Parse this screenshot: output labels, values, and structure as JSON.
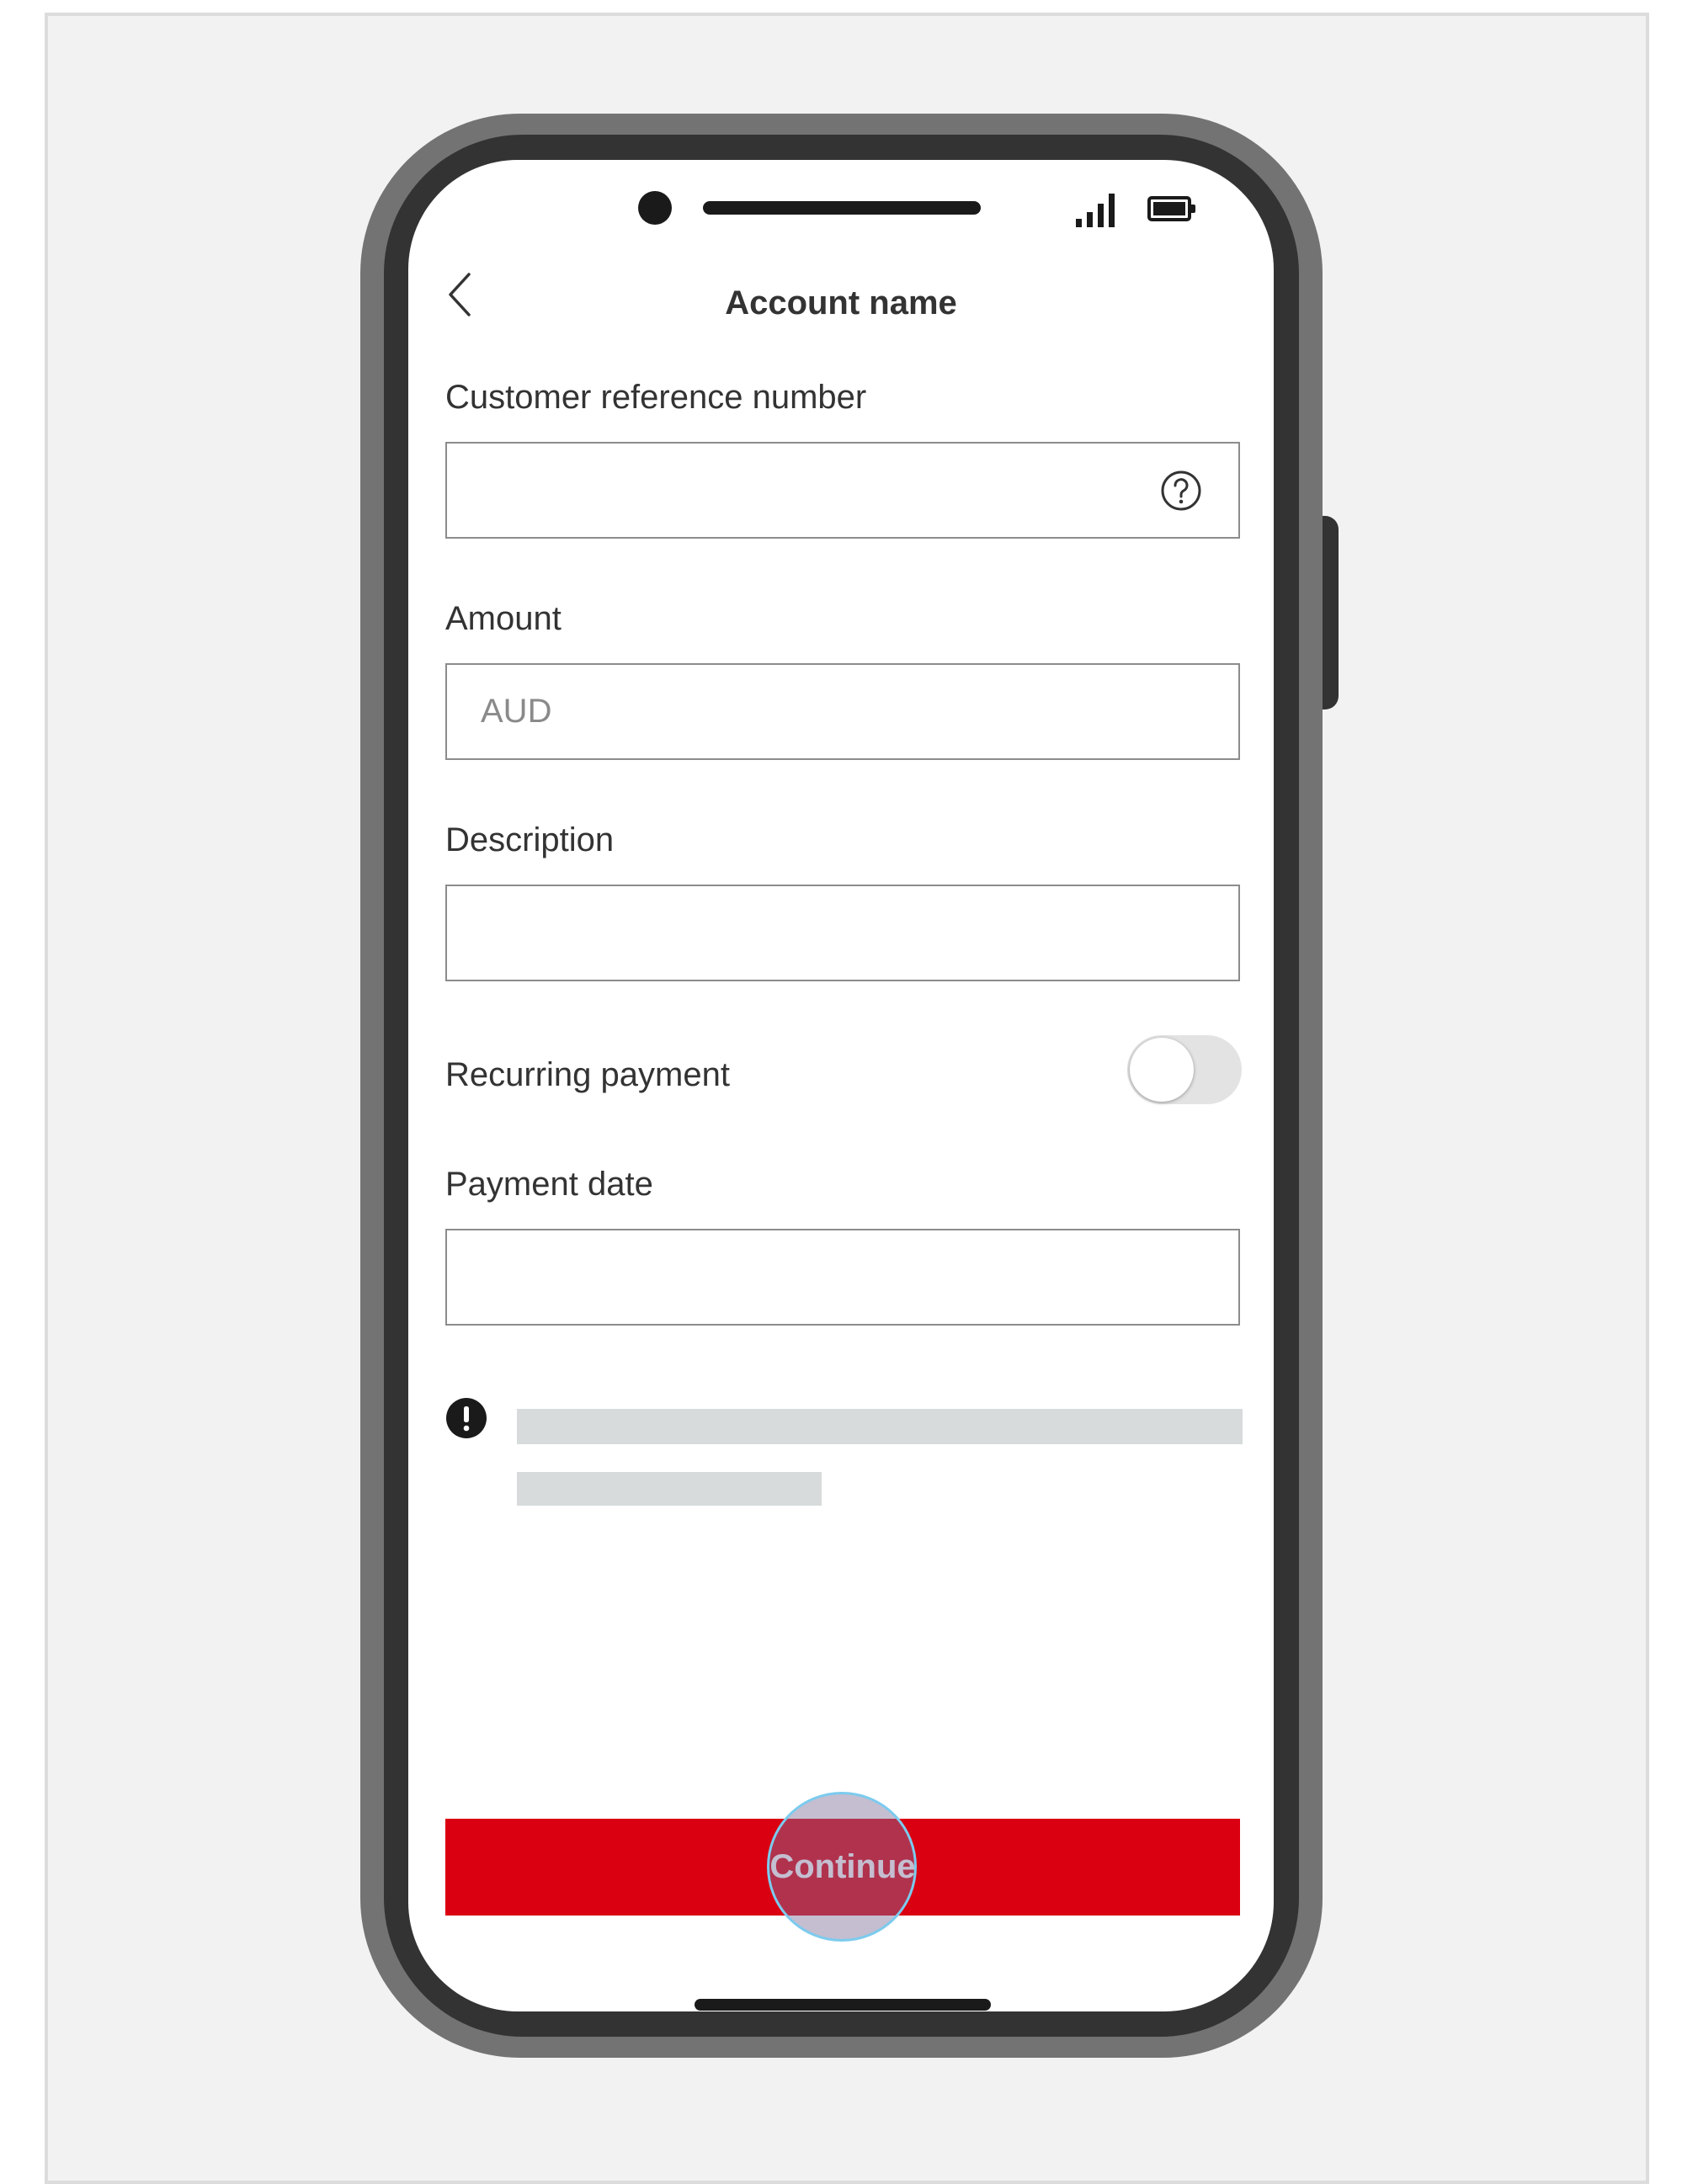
{
  "header": {
    "title": "Account name"
  },
  "form": {
    "customer_reference": {
      "label": "Customer reference number",
      "value": "",
      "placeholder": ""
    },
    "amount": {
      "label": "Amount",
      "value": "",
      "placeholder": "AUD"
    },
    "description": {
      "label": "Description",
      "value": "",
      "placeholder": ""
    },
    "recurring": {
      "label": "Recurring payment",
      "enabled": false
    },
    "payment_date": {
      "label": "Payment date",
      "value": "",
      "placeholder": ""
    }
  },
  "actions": {
    "continue_label": "Continue"
  },
  "colors": {
    "primary": "#db0011",
    "text": "#333333",
    "border": "#8c8c8c",
    "skeleton": "#d7dbdc",
    "background": "#f2f2f2"
  },
  "icons": [
    "back-chevron-icon",
    "help-icon",
    "info-icon",
    "signal-icon",
    "battery-icon"
  ]
}
